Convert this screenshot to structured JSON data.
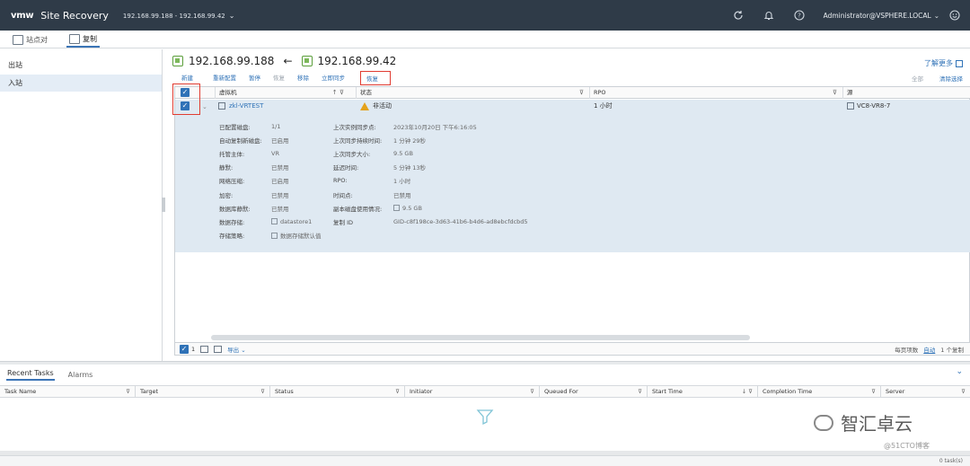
{
  "header": {
    "logo": "vmw",
    "app_title": "Site Recovery",
    "site_pair": "192.168.99.188 - 192.168.99.42",
    "user": "Administrator@VSPHERE.LOCAL"
  },
  "tabs": [
    {
      "label": "站点对"
    },
    {
      "label": "复制"
    }
  ],
  "sidebar": {
    "items": [
      {
        "label": "出站"
      },
      {
        "label": "入站"
      }
    ]
  },
  "pair": {
    "left": "192.168.99.188",
    "right": "192.168.99.42",
    "learn_more": "了解更多"
  },
  "toolbar": {
    "new": "新建",
    "reconfigure": "重新配置",
    "pause": "暂停",
    "resume": "恢复",
    "remove": "移除",
    "sync_now": "立即同步",
    "restore": "恢复",
    "right1": "全部",
    "right2": "清除选择"
  },
  "grid": {
    "columns": [
      "虚拟机",
      "状态",
      "RPO",
      "源"
    ],
    "row": {
      "vm": "zkl-VRTEST",
      "status": "非活动",
      "rpo": "1 小时",
      "source": "VC8-VR8-7"
    },
    "details_left": [
      {
        "label": "已配置磁盘:",
        "value": "1/1"
      },
      {
        "label": "自动复制新磁盘:",
        "value": "已启用"
      },
      {
        "label": "托管主体:",
        "value": "VR"
      },
      {
        "label": "静默:",
        "value": "已禁用"
      },
      {
        "label": "网络压缩:",
        "value": "已启用"
      },
      {
        "label": "加密:",
        "value": "已禁用"
      },
      {
        "label": "数据库静默:",
        "value": "已禁用"
      },
      {
        "label": "数据存储:",
        "value": "datastore1"
      },
      {
        "label": "存储策略:",
        "value": "数据存储默认值"
      }
    ],
    "details_right": [
      {
        "label": "上次实例同步点:",
        "value": "2023年10月20日 下午6:16:05"
      },
      {
        "label": "上次同步持续时间:",
        "value": "1 分钟 29秒"
      },
      {
        "label": "上次同步大小:",
        "value": "9.5 GB"
      },
      {
        "label": "延迟时间:",
        "value": "5 分钟 13秒"
      },
      {
        "label": "RPO:",
        "value": "1 小时"
      },
      {
        "label": "时间点:",
        "value": "已禁用"
      },
      {
        "label": "副本磁盘使用情况:",
        "value": "9.5 GB"
      },
      {
        "label": "复制 ID",
        "value": "GID-c8f198ce-3d63-41b6-b4d6-ad8ebcfdcbd5"
      }
    ],
    "footer": {
      "selected_count": "1",
      "export": "导出",
      "page_size_label": "每页项数",
      "page_size": "自动",
      "total": "1 个复制"
    }
  },
  "bottom": {
    "tabs": [
      "Recent Tasks",
      "Alarms"
    ],
    "columns": [
      "Task Name",
      "Target",
      "Status",
      "Initiator",
      "Queued For",
      "Start Time",
      "Completion Time",
      "Server"
    ],
    "task_count": "0 task(s)"
  },
  "watermark": {
    "main": "智汇卓云",
    "sub": "@51CTO博客"
  }
}
